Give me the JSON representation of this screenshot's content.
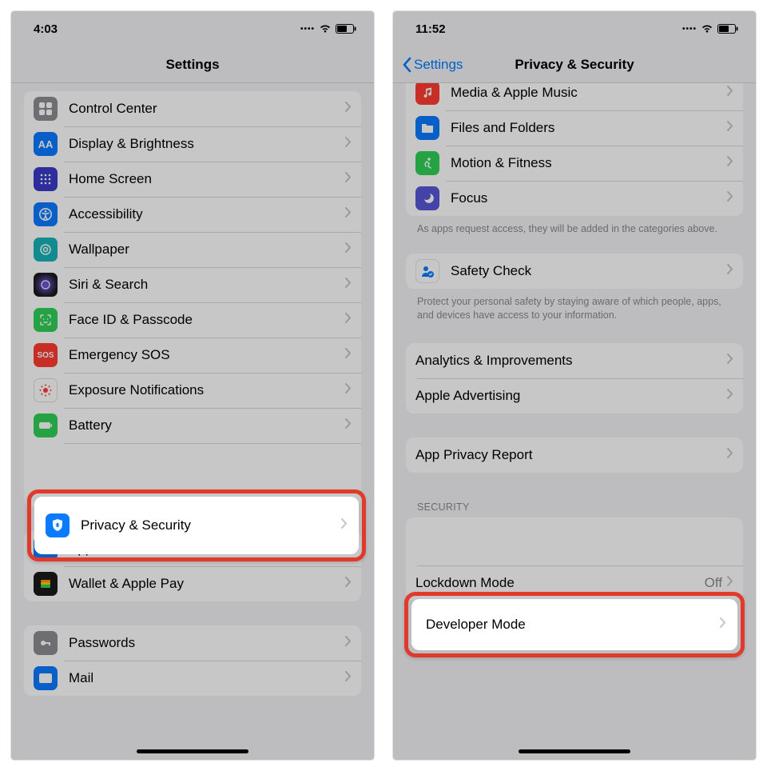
{
  "left": {
    "time": "4:03",
    "title": "Settings",
    "items": [
      {
        "label": "Control Center",
        "icon": "control-center-icon",
        "bg": "#8e8e93"
      },
      {
        "label": "Display & Brightness",
        "icon": "display-icon",
        "bg": "#0a7aff"
      },
      {
        "label": "Home Screen",
        "icon": "home-screen-icon",
        "bg": "#3a3ac7"
      },
      {
        "label": "Accessibility",
        "icon": "accessibility-icon",
        "bg": "#0a7aff"
      },
      {
        "label": "Wallpaper",
        "icon": "wallpaper-icon",
        "bg": "#17b1b9"
      },
      {
        "label": "Siri & Search",
        "icon": "siri-icon",
        "bg": "#1a1a1a"
      },
      {
        "label": "Face ID & Passcode",
        "icon": "faceid-icon",
        "bg": "#30d158"
      },
      {
        "label": "Emergency SOS",
        "icon": "sos-icon",
        "bg": "#ff3b30"
      },
      {
        "label": "Exposure Notifications",
        "icon": "exposure-icon",
        "bg": "#ffffff"
      },
      {
        "label": "Battery",
        "icon": "battery-icon",
        "bg": "#30d158"
      },
      {
        "label": "Privacy & Security",
        "icon": "privacy-icon",
        "bg": "#0a7aff"
      }
    ],
    "group2": [
      {
        "label": "App Store",
        "icon": "appstore-icon",
        "bg": "#0a7aff"
      },
      {
        "label": "Wallet & Apple Pay",
        "icon": "wallet-icon",
        "bg": "#1a1a1a"
      }
    ],
    "group3": [
      {
        "label": "Passwords",
        "icon": "passwords-icon",
        "bg": "#8e8e93"
      },
      {
        "label": "Mail",
        "icon": "mail-icon",
        "bg": "#0a7aff"
      }
    ],
    "highlight_label": "Privacy & Security"
  },
  "right": {
    "time": "11:52",
    "back": "Settings",
    "title": "Privacy & Security",
    "topItems": [
      {
        "label": "Media & Apple Music",
        "icon": "music-icon",
        "bg": "#ff3b30"
      },
      {
        "label": "Files and Folders",
        "icon": "files-icon",
        "bg": "#0a7aff"
      },
      {
        "label": "Motion & Fitness",
        "icon": "fitness-icon",
        "bg": "#30d158"
      },
      {
        "label": "Focus",
        "icon": "focus-icon",
        "bg": "#5856d6"
      }
    ],
    "footer1": "As apps request access, they will be added in the categories above.",
    "safety": {
      "label": "Safety Check",
      "icon": "safety-icon"
    },
    "footer2": "Protect your personal safety by staying aware of which people, apps, and devices have access to your information.",
    "analytics": [
      {
        "label": "Analytics & Improvements"
      },
      {
        "label": "Apple Advertising"
      }
    ],
    "appPrivacy": {
      "label": "App Privacy Report"
    },
    "securityHeader": "SECURITY",
    "security": [
      {
        "label": "Developer Mode",
        "value": ""
      },
      {
        "label": "Lockdown Mode",
        "value": "Off"
      }
    ],
    "highlight_label": "Developer Mode"
  }
}
